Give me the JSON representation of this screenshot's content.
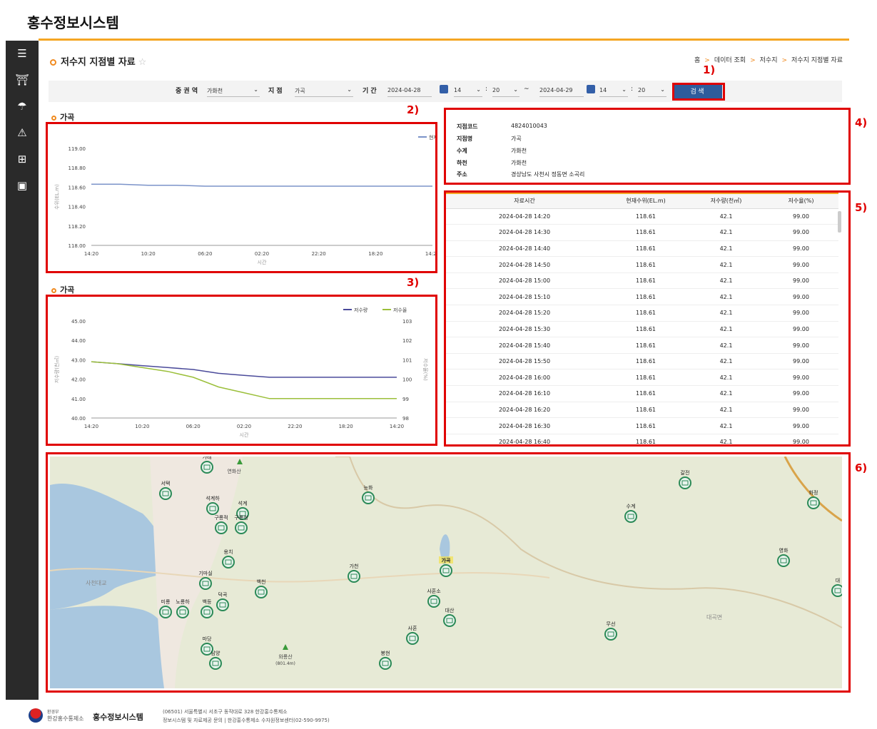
{
  "app": {
    "title": "홍수정보시스템"
  },
  "page": {
    "title": "저수지 지점별 자료",
    "star": "☆"
  },
  "breadcrumb": {
    "home": "홈",
    "sep": ">",
    "item1": "데이터 조회",
    "item2": "저수지",
    "item3": "저수지 지점별 자료"
  },
  "search": {
    "region_label": "중 권 역",
    "region_value": "가화천",
    "site_label": "지 점",
    "site_value": "가곡",
    "period_label": "기 간",
    "start_date": "2024-04-28",
    "start_hour": "14",
    "start_min": "20",
    "end_date": "2024-04-29",
    "end_hour": "14",
    "end_min": "20",
    "colon": ":",
    "tilde": "~",
    "button": "검 색"
  },
  "chart1": {
    "section_title": "가곡"
  },
  "chart2": {
    "section_title": "가곡"
  },
  "chart_data": [
    {
      "type": "line",
      "title": "가곡",
      "legend": "top-right",
      "x": [
        "14:20",
        "10:20",
        "06:20",
        "02:20",
        "22:20",
        "18:20",
        "14:20"
      ],
      "xlabel": "시간",
      "ylabel": "수위(EL.m)",
      "ylim": [
        118.0,
        119.0
      ],
      "yticks": [
        "119.00",
        "118.80",
        "118.60",
        "118.40",
        "118.20",
        "118.00"
      ],
      "series": [
        {
          "name": "현재수위",
          "color": "#7b93c9",
          "values": [
            118.63,
            118.63,
            118.62,
            118.62,
            118.61,
            118.61,
            118.61,
            118.61,
            118.61,
            118.61,
            118.61,
            118.61,
            118.61
          ]
        }
      ]
    },
    {
      "type": "line",
      "title": "가곡",
      "legend": "top-right",
      "x": [
        "14:20",
        "10:20",
        "06:20",
        "02:20",
        "22:20",
        "18:20",
        "14:20"
      ],
      "xlabel": "시간",
      "ylabel": "저수량(천㎥)",
      "ylabel_right": "저수율(%)",
      "ylim": [
        40.0,
        45.0
      ],
      "ylim_right": [
        98,
        103
      ],
      "yticks": [
        "45.00",
        "44.00",
        "43.00",
        "42.00",
        "41.00",
        "40.00"
      ],
      "yticks_right": [
        "103",
        "102",
        "101",
        "100",
        "99",
        "98"
      ],
      "series": [
        {
          "name": "저수량",
          "color": "#4a4a9a",
          "values": [
            42.9,
            42.8,
            42.7,
            42.6,
            42.5,
            42.3,
            42.2,
            42.1,
            42.1,
            42.1,
            42.1,
            42.1,
            42.1
          ]
        },
        {
          "name": "저수율",
          "color": "#9bbf3a",
          "values": [
            100.9,
            100.8,
            100.6,
            100.4,
            100.1,
            99.6,
            99.3,
            99.0,
            99.0,
            99.0,
            99.0,
            99.0,
            99.0
          ]
        }
      ]
    }
  ],
  "info": {
    "rows": [
      {
        "k": "지점코드",
        "v": "4824010043"
      },
      {
        "k": "지점명",
        "v": "가곡"
      },
      {
        "k": "수계",
        "v": "가화천"
      },
      {
        "k": "하천",
        "v": "가화천"
      },
      {
        "k": "주소",
        "v": "경상남도 사천시 정동면 소곡리"
      }
    ]
  },
  "table": {
    "headers": [
      "자료시간",
      "현재수위(EL.m)",
      "저수량(천㎥)",
      "저수율(%)"
    ],
    "rows": [
      [
        "2024-04-28 14:20",
        "118.61",
        "42.1",
        "99.00"
      ],
      [
        "2024-04-28 14:30",
        "118.61",
        "42.1",
        "99.00"
      ],
      [
        "2024-04-28 14:40",
        "118.61",
        "42.1",
        "99.00"
      ],
      [
        "2024-04-28 14:50",
        "118.61",
        "42.1",
        "99.00"
      ],
      [
        "2024-04-28 15:00",
        "118.61",
        "42.1",
        "99.00"
      ],
      [
        "2024-04-28 15:10",
        "118.61",
        "42.1",
        "99.00"
      ],
      [
        "2024-04-28 15:20",
        "118.61",
        "42.1",
        "99.00"
      ],
      [
        "2024-04-28 15:30",
        "118.61",
        "42.1",
        "99.00"
      ],
      [
        "2024-04-28 15:40",
        "118.61",
        "42.1",
        "99.00"
      ],
      [
        "2024-04-28 15:50",
        "118.61",
        "42.1",
        "99.00"
      ],
      [
        "2024-04-28 16:00",
        "118.61",
        "42.1",
        "99.00"
      ],
      [
        "2024-04-28 16:10",
        "118.61",
        "42.1",
        "99.00"
      ],
      [
        "2024-04-28 16:20",
        "118.61",
        "42.1",
        "99.00"
      ],
      [
        "2024-04-28 16:30",
        "118.61",
        "42.1",
        "99.00"
      ],
      [
        "2024-04-28 16:40",
        "118.61",
        "42.1",
        "99.00"
      ]
    ]
  },
  "annotations": [
    "1)",
    "2)",
    "3)",
    "4)",
    "5)",
    "6)"
  ],
  "map": {
    "markers": [
      {
        "name": "가래"
      },
      {
        "name": "서택"
      },
      {
        "name": "석계하"
      },
      {
        "name": "석계"
      },
      {
        "name": "구룡적"
      },
      {
        "name": "구룡청"
      },
      {
        "name": "용치"
      },
      {
        "name": "기마실"
      },
      {
        "name": "덕곡"
      },
      {
        "name": "백천"
      },
      {
        "name": "미룡"
      },
      {
        "name": "노룡하"
      },
      {
        "name": "백등"
      },
      {
        "name": "마당"
      },
      {
        "name": "남양"
      },
      {
        "name": "능화"
      },
      {
        "name": "가천"
      },
      {
        "name": "가곡"
      },
      {
        "name": "사혼소"
      },
      {
        "name": "대산"
      },
      {
        "name": "사혼"
      },
      {
        "name": "봉현"
      },
      {
        "name": "수계"
      },
      {
        "name": "무선"
      },
      {
        "name": "갈전"
      },
      {
        "name": "화정"
      },
      {
        "name": "영화"
      },
      {
        "name": "대"
      }
    ],
    "labels": {
      "mountain1": "연화산",
      "mountain2": "와룡산",
      "mountain2_sub": "(801.4m)",
      "area1": "사천대교",
      "area2": "대곡면"
    }
  },
  "footer": {
    "org_line1": "환경부",
    "org_line2": "한강홍수통제소",
    "system": "홍수정보시스템",
    "addr": "(06501) 서울특별시 서초구 동작대로 328 한강홍수통제소",
    "links": "정보시스템 및 자료제공 문의 | 한강홍수통제소 수자원정보센터(02-590-9975)"
  },
  "colors": {
    "accent": "#f5a623",
    "primary": "#2e5c9c",
    "annotation": "#e00000",
    "sidebar": "#2a2a2a"
  }
}
